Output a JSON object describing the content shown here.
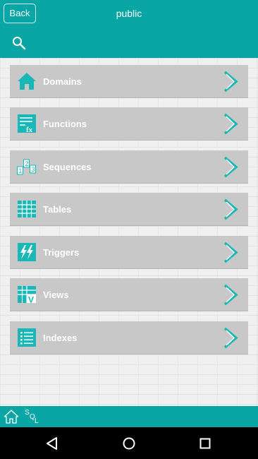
{
  "header": {
    "back_label": "Back",
    "title": "public",
    "search_icon": "search-icon"
  },
  "menu": {
    "items": [
      {
        "label": "Domains",
        "icon": "house-icon"
      },
      {
        "label": "Functions",
        "icon": "function-icon"
      },
      {
        "label": "Sequences",
        "icon": "sequence-icon"
      },
      {
        "label": "Tables",
        "icon": "table-icon"
      },
      {
        "label": "Triggers",
        "icon": "trigger-icon"
      },
      {
        "label": "Views",
        "icon": "view-icon"
      },
      {
        "label": "Indexes",
        "icon": "index-icon"
      }
    ]
  },
  "bottom_bar": {
    "home_icon": "home-icon",
    "sql_letters": [
      "S",
      "Q",
      "L"
    ]
  },
  "system_nav": [
    "back-triangle-icon",
    "home-circle-icon",
    "recents-square-icon"
  ],
  "colors": {
    "accent": "#0aa6a6",
    "item_bg": "#c8c8c8",
    "icon": "#1ab7b7"
  }
}
